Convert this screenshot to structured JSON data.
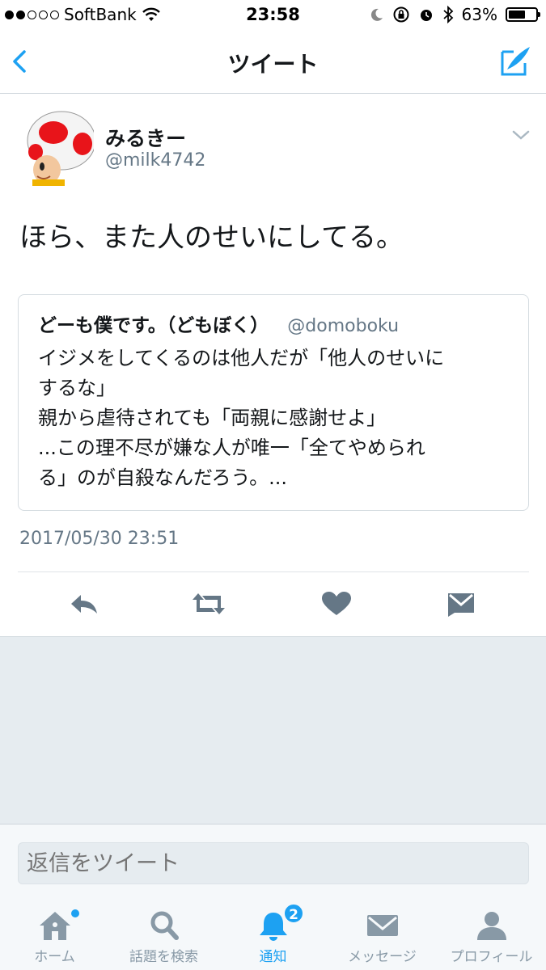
{
  "status_bar": {
    "carrier": "SoftBank",
    "time": "23:58",
    "battery_percent": "63%",
    "battery_level": 0.63,
    "icons": [
      "signal-dots-icon",
      "wifi-icon",
      "moon-icon",
      "rotation-lock-icon",
      "alarm-icon",
      "bluetooth-icon",
      "battery-icon"
    ]
  },
  "nav": {
    "title": "ツイート",
    "back_icon": "chevron-left-icon",
    "compose_icon": "compose-icon"
  },
  "tweet": {
    "display_name": "みるきー",
    "handle": "@milk4742",
    "text": "ほら、また人のせいにしてる。",
    "timestamp": "2017/05/30 23:51",
    "quote": {
      "display_name": "どーも僕です。（どもぼく）",
      "handle": "@domoboku",
      "lines": [
        "イジメをしてくるのは他人だが「他人のせいに",
        "するな」",
        "親から虐待されても「両親に感謝せよ」",
        "...この理不尽が嫌な人が唯一「全てやめられ",
        "る」のが自殺なんだろう。..."
      ]
    }
  },
  "actions": [
    "reply-icon",
    "retweet-icon",
    "like-icon",
    "direct-message-icon"
  ],
  "reply": {
    "placeholder": "返信をツイート"
  },
  "tabs": [
    {
      "label": "ホーム",
      "icon": "home-icon"
    },
    {
      "label": "話題を検索",
      "icon": "search-icon"
    },
    {
      "label": "通知",
      "icon": "bell-icon",
      "badge": "2",
      "active": true
    },
    {
      "label": "メッセージ",
      "icon": "envelope-icon"
    },
    {
      "label": "プロフィール",
      "icon": "person-icon"
    }
  ],
  "colors": {
    "accent": "#1da1f2",
    "text": "#14171a",
    "secondary": "#657786",
    "icon_gray": "#8899a6",
    "background_gray": "#e6ecf0"
  }
}
